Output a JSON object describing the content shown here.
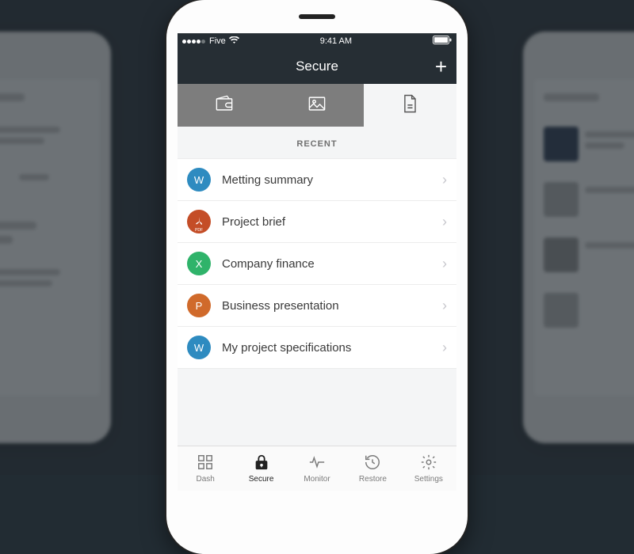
{
  "status": {
    "carrier": "Five",
    "time": "9:41 AM"
  },
  "nav": {
    "title": "Secure"
  },
  "section_header": "RECENT",
  "filetype_colors": {
    "word": "#2e8bc0",
    "pdf": "#c44d27",
    "excel": "#2fb36a",
    "ppt": "#d06a2b"
  },
  "items": [
    {
      "label": "Metting summary",
      "badge": "W",
      "type": "word"
    },
    {
      "label": "Project brief",
      "badge": "",
      "type": "pdf"
    },
    {
      "label": "Company finance",
      "badge": "X",
      "type": "excel"
    },
    {
      "label": "Business presentation",
      "badge": "P",
      "type": "ppt"
    },
    {
      "label": "My project specifications",
      "badge": "W",
      "type": "word"
    }
  ],
  "tabs": [
    {
      "label": "Dash"
    },
    {
      "label": "Secure"
    },
    {
      "label": "Monitor"
    },
    {
      "label": "Restore"
    },
    {
      "label": "Settings"
    }
  ]
}
